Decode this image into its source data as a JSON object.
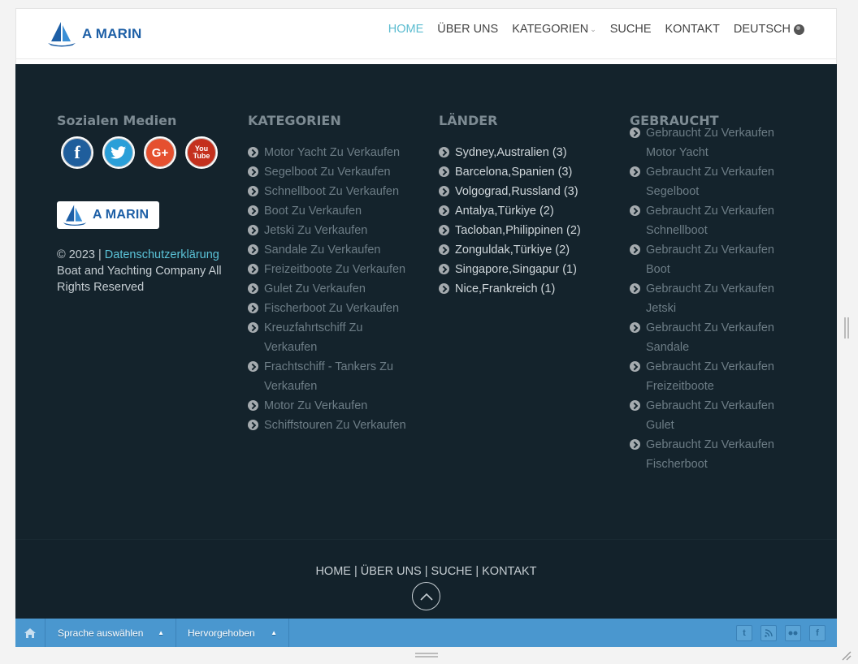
{
  "brand": {
    "name": "A MARIN",
    "accent": "#5bbcd0",
    "logo_blue": "#1d5fa6"
  },
  "nav": {
    "items": [
      {
        "label": "HOME",
        "active": true
      },
      {
        "label": "ÜBER UNS"
      },
      {
        "label": "KATEGORIEN"
      },
      {
        "label": "SUCHE"
      },
      {
        "label": "KONTAKT"
      },
      {
        "label": "DEUTSCH"
      }
    ]
  },
  "footer": {
    "social": {
      "title": "Sozialen Medien",
      "icons": [
        "facebook-icon",
        "twitter-icon",
        "google-plus-icon",
        "youtube-icon"
      ]
    },
    "copyright": {
      "prefix": "© 2023 |",
      "link": "Datenschutzerklärung",
      "suffix": "Boat and Yachting Company All Rights Reserved"
    },
    "kategorien": {
      "title": "KATEGORIEN",
      "items": [
        "Motor Yacht Zu Verkaufen",
        "Segelboot Zu Verkaufen",
        "Schnellboot Zu Verkaufen",
        "Boot Zu Verkaufen",
        "Jetski Zu Verkaufen",
        "Sandale Zu Verkaufen",
        "Freizeitboote Zu Verkaufen",
        "Gulet Zu Verkaufen",
        "Fischerboot Zu Verkaufen",
        "Kreuzfahrtschiff Zu Verkaufen",
        "Frachtschiff - Tankers Zu Verkaufen",
        "Motor Zu Verkaufen",
        "Schiffstouren Zu Verkaufen"
      ]
    },
    "laender": {
      "title": "LÄNDER",
      "items": [
        "Sydney,Australien (3)",
        "Barcelona,Spanien (3)",
        "Volgograd,Russland (3)",
        "Antalya,Türkiye (2)",
        "Tacloban,Philippinen (2)",
        "Zonguldak,Türkiye (2)",
        "Singapore,Singapur (1)",
        "Nice,Frankreich (1)"
      ]
    },
    "gebraucht": {
      "title": "GEBRAUCHT",
      "items": [
        "Gebraucht Zu Verkaufen Motor Yacht",
        "Gebraucht Zu Verkaufen Segelboot",
        "Gebraucht Zu Verkaufen Schnellboot",
        "Gebraucht Zu Verkaufen Boot",
        "Gebraucht Zu Verkaufen Jetski",
        "Gebraucht Zu Verkaufen Sandale",
        "Gebraucht Zu Verkaufen Freizeitboote",
        "Gebraucht Zu Verkaufen Gulet",
        "Gebraucht Zu Verkaufen Fischerboot"
      ]
    },
    "bottom_links": [
      "HOME",
      "ÜBER UNS",
      "SUCHE",
      "KONTAKT"
    ]
  },
  "toolbar": {
    "language_label": "Sprache auswählen",
    "featured_label": "Hervorgehoben",
    "icons": [
      "twitter-icon",
      "rss-icon",
      "flickr-icon",
      "facebook-icon"
    ]
  }
}
